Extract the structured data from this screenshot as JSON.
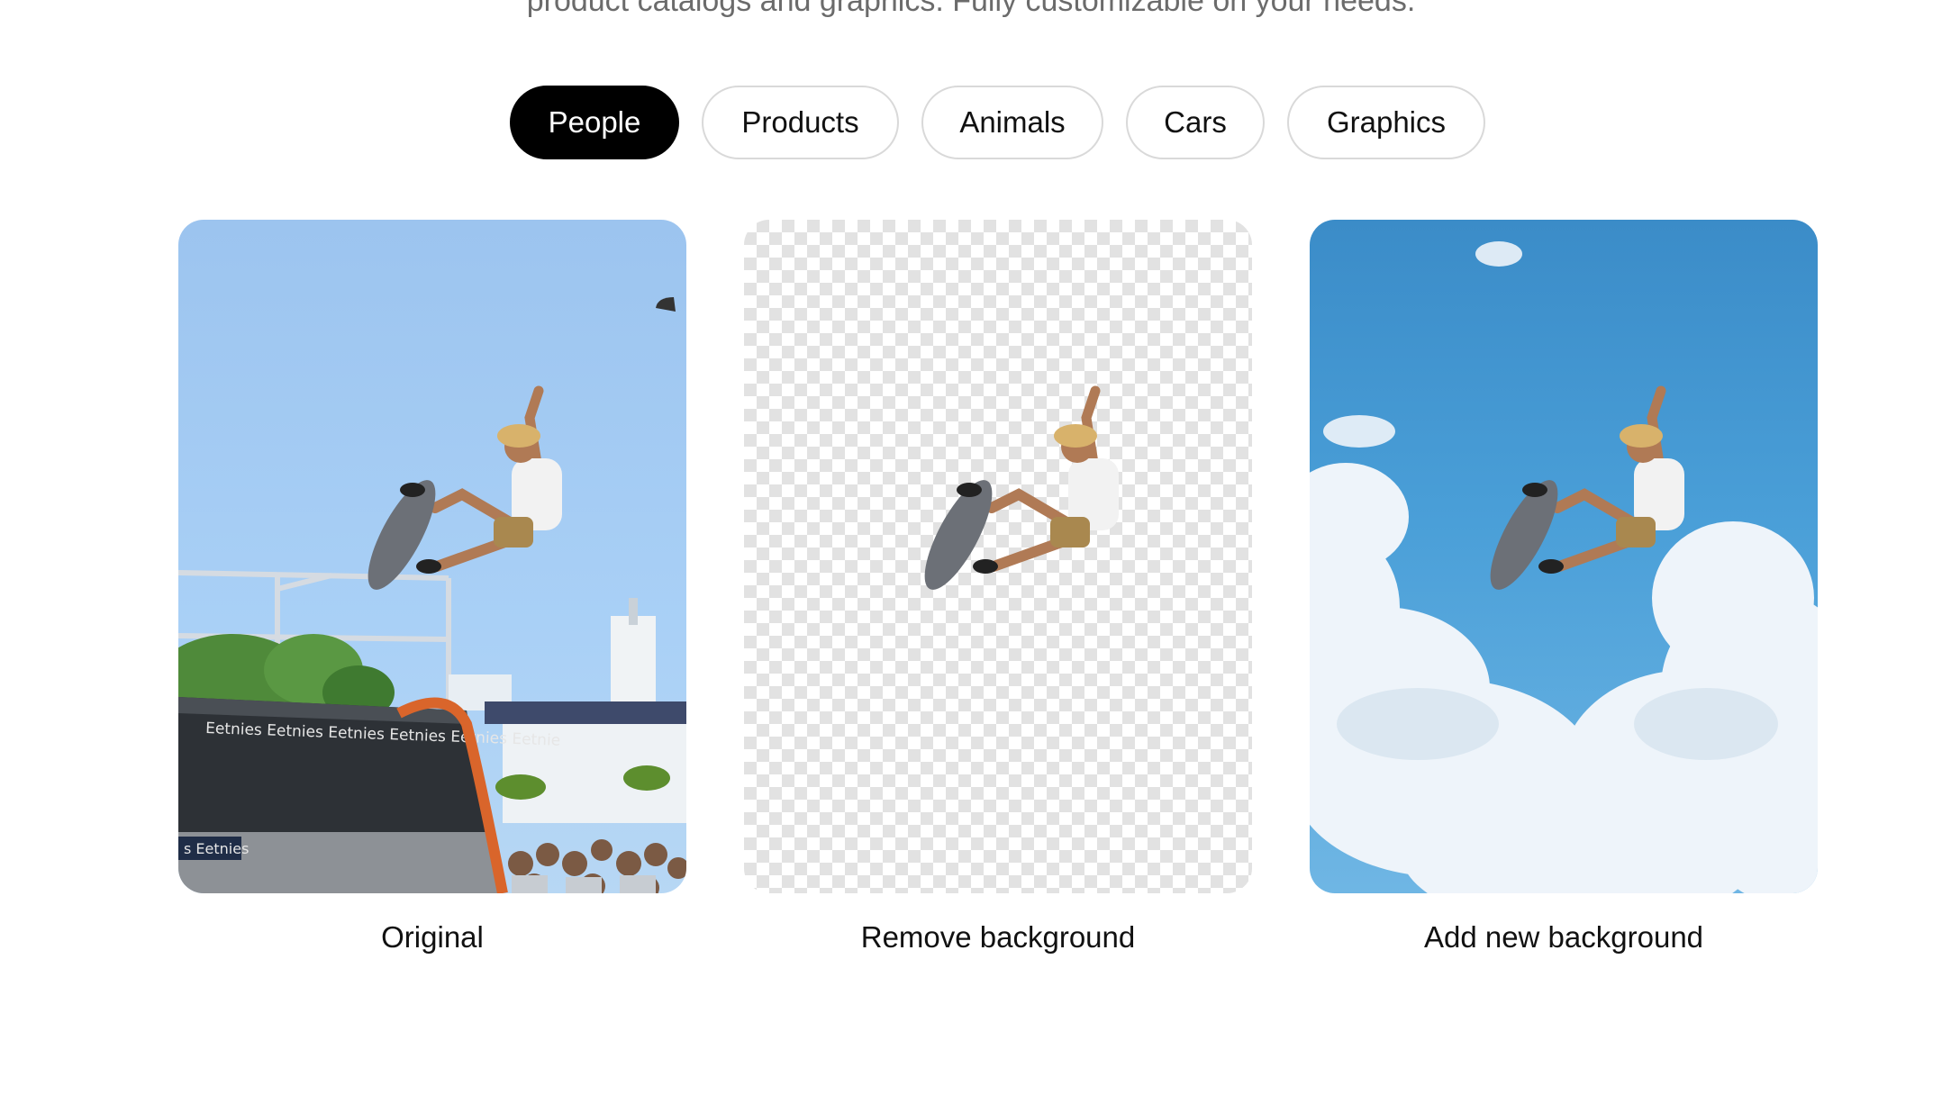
{
  "intro": {
    "text": "product catalogs and graphics. Fully customizable on your needs."
  },
  "tabs": [
    {
      "label": "People",
      "active": true
    },
    {
      "label": "Products",
      "active": false
    },
    {
      "label": "Animals",
      "active": false
    },
    {
      "label": "Cars",
      "active": false
    },
    {
      "label": "Graphics",
      "active": false
    }
  ],
  "cards": {
    "original": {
      "caption": "Original",
      "ramp_text": "Eetnies Eetnies Eetnies Eetnies Eetnies Eetnie",
      "ramp_text_2": "s Eetnies"
    },
    "remove": {
      "caption": "Remove background"
    },
    "add": {
      "caption": "Add new background"
    }
  },
  "colors": {
    "active_tab_bg": "#000000",
    "tab_border": "#d9d9d9"
  }
}
